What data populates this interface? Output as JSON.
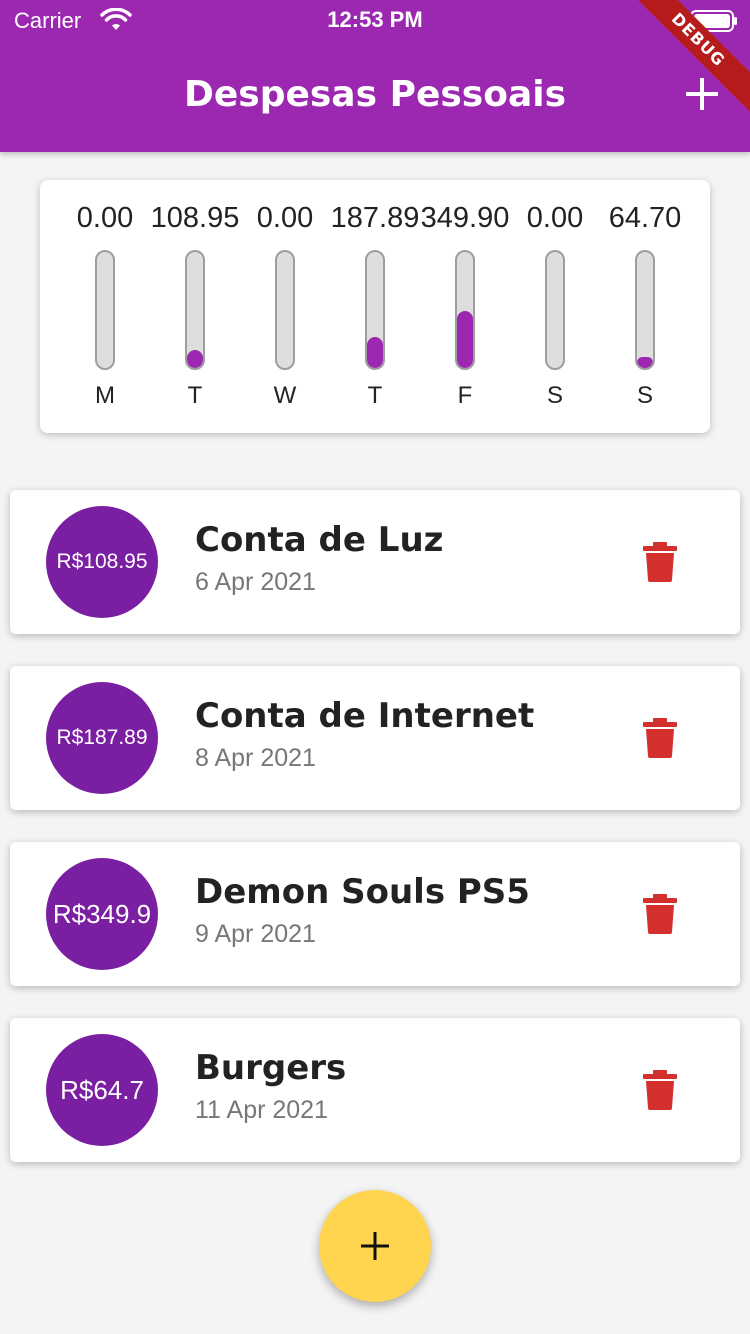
{
  "status_bar": {
    "carrier": "Carrier",
    "time": "12:53 PM"
  },
  "app_bar": {
    "title": "Despesas Pessoais",
    "debug_label": "DEBUG",
    "color": "#9c27b0"
  },
  "chart_data": {
    "type": "bar",
    "categories": [
      "M",
      "T",
      "W",
      "T",
      "F",
      "S",
      "S"
    ],
    "values": [
      0.0,
      108.95,
      0.0,
      187.89,
      349.9,
      0.0,
      64.7
    ],
    "value_labels": [
      "0.00",
      "108.95",
      "0.00",
      "187.89",
      "349.90",
      "0.00",
      "64.70"
    ],
    "title": "",
    "xlabel": "",
    "ylabel": "",
    "bar_color": "#9c27b0"
  },
  "transactions": [
    {
      "amount": "R$108.95",
      "title": "Conta de Luz",
      "date": "6 Apr 2021"
    },
    {
      "amount": "R$187.89",
      "title": "Conta de Internet",
      "date": "8 Apr 2021"
    },
    {
      "amount": "R$349.9",
      "title": "Demon Souls PS5",
      "date": "9 Apr 2021"
    },
    {
      "amount": "R$64.7",
      "title": "Burgers",
      "date": "11 Apr 2021"
    }
  ],
  "icons": {
    "add": "plus-icon",
    "delete": "trash-icon",
    "fab": "plus-icon"
  },
  "colors": {
    "accent": "#9c27b0",
    "avatar": "#7b1fa2",
    "delete": "#d32f2f",
    "fab": "#ffd54f"
  }
}
